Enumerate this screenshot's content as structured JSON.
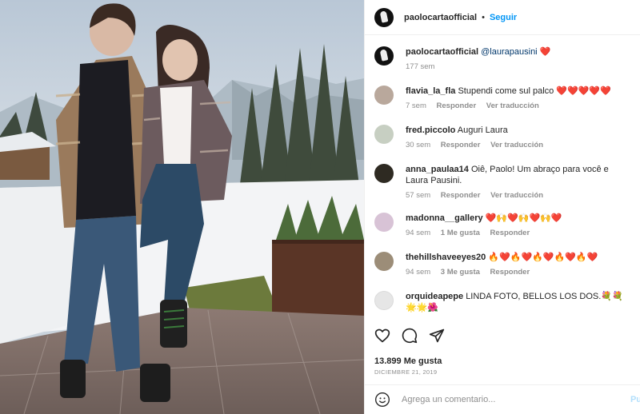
{
  "header": {
    "username": "paolocartaofficial",
    "separator": "•",
    "follow_label": "Seguir"
  },
  "caption": {
    "username": "paolocartaofficial",
    "mention": "@laurapausini",
    "emoji": "❤️",
    "time": "177 sem"
  },
  "comments": [
    {
      "username": "flavia_la_fla",
      "text": "Stupendi come sul palco ❤️❤️❤️❤️❤️",
      "time": "7 sem",
      "likes": "",
      "reply": "Responder",
      "translate": "Ver traducción"
    },
    {
      "username": "fred.piccolo",
      "text": "Auguri Laura",
      "time": "30 sem",
      "likes": "",
      "reply": "Responder",
      "translate": "Ver traducción"
    },
    {
      "username": "anna_paulaa14",
      "text": "Oiê, Paolo! Um abraço para você e Laura Pausini.",
      "time": "57 sem",
      "likes": "",
      "reply": "Responder",
      "translate": "Ver traducción"
    },
    {
      "username": "madonna__gallery",
      "text": "❤️🙌❤️🙌❤️🙌❤️",
      "time": "94 sem",
      "likes": "1 Me gusta",
      "reply": "Responder",
      "translate": ""
    },
    {
      "username": "thehillshaveeyes20",
      "text": "🔥❤️🔥❤️🔥❤️🔥❤️🔥❤️",
      "time": "94 sem",
      "likes": "3 Me gusta",
      "reply": "Responder",
      "translate": ""
    },
    {
      "username": "orquideapepe",
      "text": "LINDA FOTO, BELLOS LOS DOS.💐💐🌟🌟🌺",
      "time": "",
      "likes": "",
      "reply": "",
      "translate": ""
    }
  ],
  "stats": {
    "likes": "13.899 Me gusta",
    "date": "DICIEMBRE 21, 2019"
  },
  "composer": {
    "placeholder": "Agrega un comentario...",
    "post_label": "Pu"
  },
  "icons": {
    "like": "heart-icon",
    "comment": "comment-icon",
    "share": "share-icon",
    "emoji": "emoji-icon"
  },
  "colors": {
    "accent": "#0095f6",
    "muted": "#8e8e8e",
    "border": "#efefef"
  }
}
